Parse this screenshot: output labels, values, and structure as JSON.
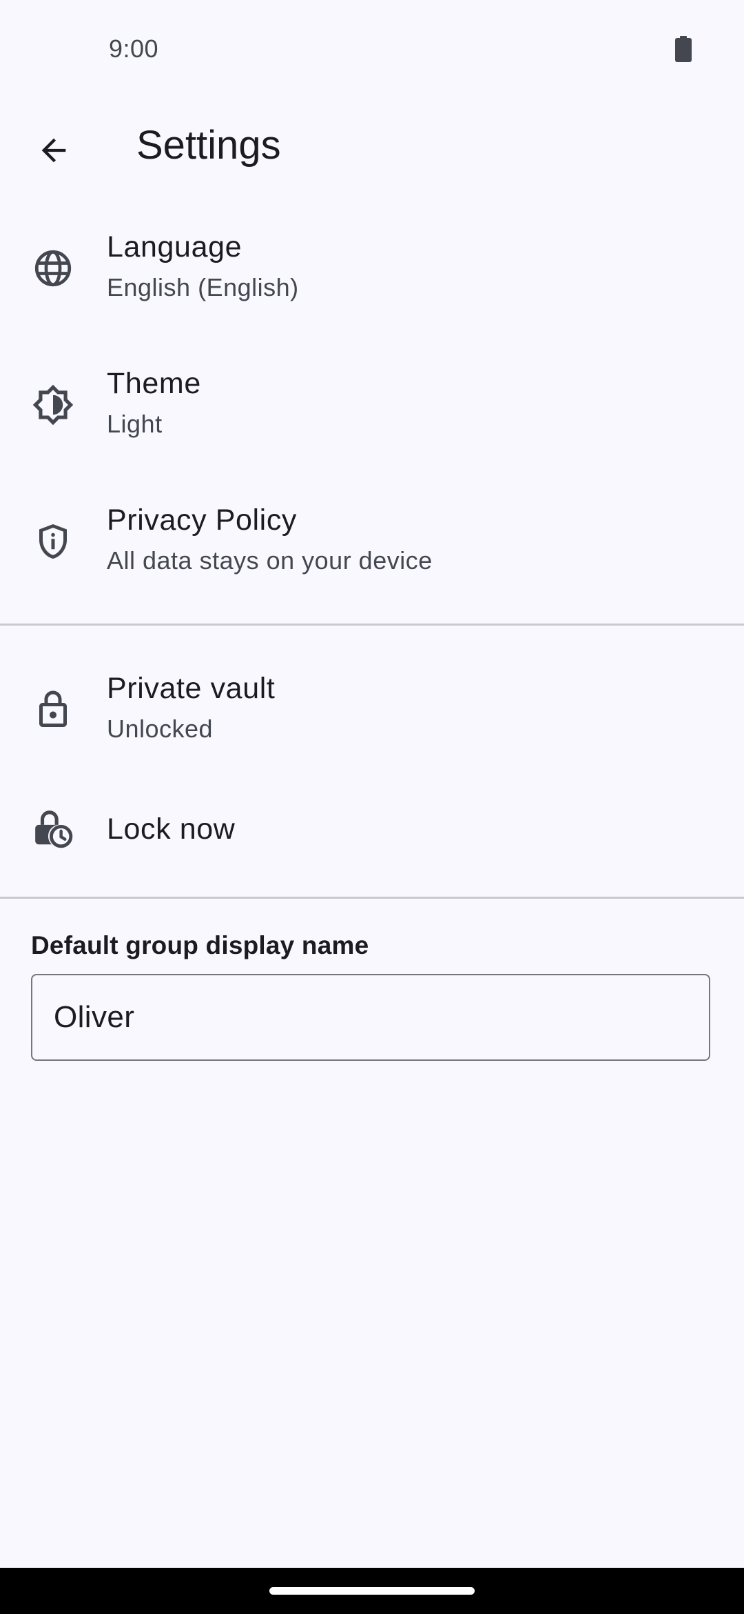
{
  "status_bar": {
    "time": "9:00",
    "battery_icon": "battery-full-icon"
  },
  "app_bar": {
    "back_icon": "arrow-back-icon",
    "title": "Settings"
  },
  "settings_items": [
    {
      "icon": "globe-icon",
      "title": "Language",
      "subtitle": "English (English)"
    },
    {
      "icon": "brightness-theme-icon",
      "title": "Theme",
      "subtitle": "Light"
    },
    {
      "icon": "shield-icon",
      "title": "Privacy Policy",
      "subtitle": "All data stays on your device"
    },
    {
      "icon": "lock-icon",
      "title": "Private vault",
      "subtitle": "Unlocked"
    },
    {
      "icon": "lock-clock-icon",
      "title": "Lock now"
    }
  ],
  "group_name_field": {
    "label": "Default group display name",
    "value": "Oliver"
  },
  "colors": {
    "background": "#f8f8fe",
    "icon": "#44474f",
    "divider": "#c9c9d0",
    "nav_bar": "#000000"
  }
}
